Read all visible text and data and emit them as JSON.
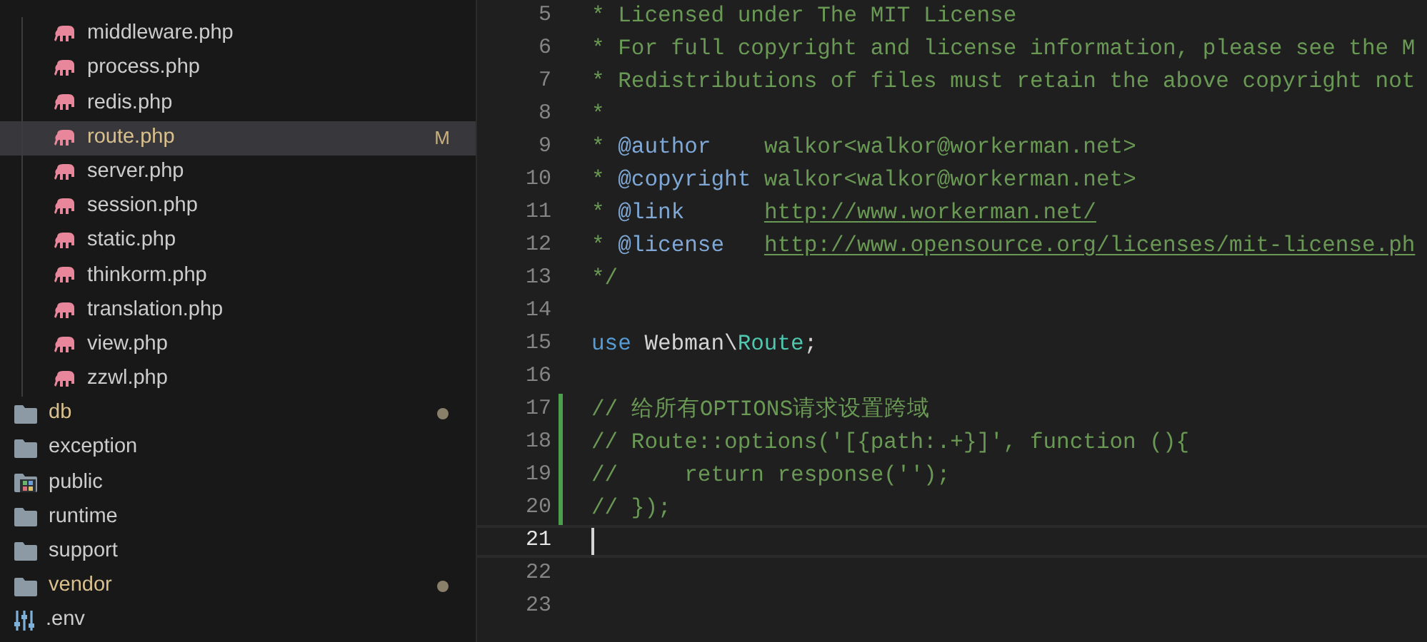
{
  "sidebar": {
    "items": [
      {
        "name": "middleware.php",
        "kind": "php",
        "selected": false,
        "modified": false
      },
      {
        "name": "process.php",
        "kind": "php",
        "selected": false,
        "modified": false
      },
      {
        "name": "redis.php",
        "kind": "php",
        "selected": false,
        "modified": false
      },
      {
        "name": "route.php",
        "kind": "php",
        "selected": true,
        "modified": true,
        "badge": "M"
      },
      {
        "name": "server.php",
        "kind": "php",
        "selected": false,
        "modified": false
      },
      {
        "name": "session.php",
        "kind": "php",
        "selected": false,
        "modified": false
      },
      {
        "name": "static.php",
        "kind": "php",
        "selected": false,
        "modified": false
      },
      {
        "name": "thinkorm.php",
        "kind": "php",
        "selected": false,
        "modified": false
      },
      {
        "name": "translation.php",
        "kind": "php",
        "selected": false,
        "modified": false
      },
      {
        "name": "view.php",
        "kind": "php",
        "selected": false,
        "modified": false
      },
      {
        "name": "zzwl.php",
        "kind": "php",
        "selected": false,
        "modified": false
      },
      {
        "name": "db",
        "kind": "folder",
        "selected": false,
        "modified": true
      },
      {
        "name": "exception",
        "kind": "folder",
        "selected": false,
        "modified": false
      },
      {
        "name": "public",
        "kind": "public-folder",
        "selected": false,
        "modified": false
      },
      {
        "name": "runtime",
        "kind": "folder",
        "selected": false,
        "modified": false
      },
      {
        "name": "support",
        "kind": "folder",
        "selected": false,
        "modified": false
      },
      {
        "name": "vendor",
        "kind": "folder",
        "selected": false,
        "modified": true
      },
      {
        "name": ".env",
        "kind": "env",
        "selected": false,
        "modified": false
      }
    ]
  },
  "editor": {
    "lines": [
      {
        "number": "5",
        "current": false,
        "changed": false,
        "tokens": [
          {
            "t": "* Licensed under The MIT License",
            "kind": "comment"
          }
        ]
      },
      {
        "number": "6",
        "current": false,
        "changed": false,
        "tokens": [
          {
            "t": "* For full copyright and license information, please see the M",
            "kind": "comment"
          }
        ]
      },
      {
        "number": "7",
        "current": false,
        "changed": false,
        "tokens": [
          {
            "t": "* Redistributions of files must retain the above copyright not",
            "kind": "comment"
          }
        ]
      },
      {
        "number": "8",
        "current": false,
        "changed": false,
        "tokens": [
          {
            "t": "*",
            "kind": "comment"
          }
        ]
      },
      {
        "number": "9",
        "current": false,
        "changed": false,
        "tokens": [
          {
            "t": "* ",
            "kind": "comment"
          },
          {
            "t": "@author",
            "kind": "tag"
          },
          {
            "t": "    walkor<walkor@workerman.net>",
            "kind": "comment"
          }
        ]
      },
      {
        "number": "10",
        "current": false,
        "changed": false,
        "tokens": [
          {
            "t": "* ",
            "kind": "comment"
          },
          {
            "t": "@copyright",
            "kind": "tag"
          },
          {
            "t": " walkor<walkor@workerman.net>",
            "kind": "comment"
          }
        ]
      },
      {
        "number": "11",
        "current": false,
        "changed": false,
        "tokens": [
          {
            "t": "* ",
            "kind": "comment"
          },
          {
            "t": "@link      ",
            "kind": "tag"
          },
          {
            "t": "http://www.workerman.net/",
            "kind": "link"
          }
        ]
      },
      {
        "number": "12",
        "current": false,
        "changed": false,
        "tokens": [
          {
            "t": "* ",
            "kind": "comment"
          },
          {
            "t": "@license   ",
            "kind": "tag"
          },
          {
            "t": "http://www.opensource.org/licenses/mit-license.ph",
            "kind": "link"
          }
        ]
      },
      {
        "number": "13",
        "current": false,
        "changed": false,
        "tokens": [
          {
            "t": "*/",
            "kind": "comment"
          }
        ]
      },
      {
        "number": "14",
        "current": false,
        "changed": false
      },
      {
        "number": "15",
        "current": false,
        "changed": false,
        "tokens": [
          {
            "t": "use",
            "kind": "keyword"
          },
          {
            "t": " Webman\\",
            "kind": "plain"
          },
          {
            "t": "Route",
            "kind": "class"
          },
          {
            "t": ";",
            "kind": "plain"
          }
        ]
      },
      {
        "number": "16",
        "current": false,
        "changed": false
      },
      {
        "number": "17",
        "current": false,
        "changed": true,
        "tokens": [
          {
            "t": "// 给所有OPTIONS请求设置跨域",
            "kind": "comment"
          }
        ]
      },
      {
        "number": "18",
        "current": false,
        "changed": true,
        "tokens": [
          {
            "t": "// Route::options('[{path:.+}]', function (){",
            "kind": "comment"
          }
        ]
      },
      {
        "number": "19",
        "current": false,
        "changed": true,
        "tokens": [
          {
            "t": "//     return response('');",
            "kind": "comment"
          }
        ]
      },
      {
        "number": "20",
        "current": false,
        "changed": true,
        "tokens": [
          {
            "t": "// });",
            "kind": "comment"
          }
        ]
      },
      {
        "number": "21",
        "current": true,
        "changed": false
      },
      {
        "number": "22",
        "current": false,
        "changed": false
      },
      {
        "number": "23",
        "current": false,
        "changed": false
      }
    ]
  }
}
